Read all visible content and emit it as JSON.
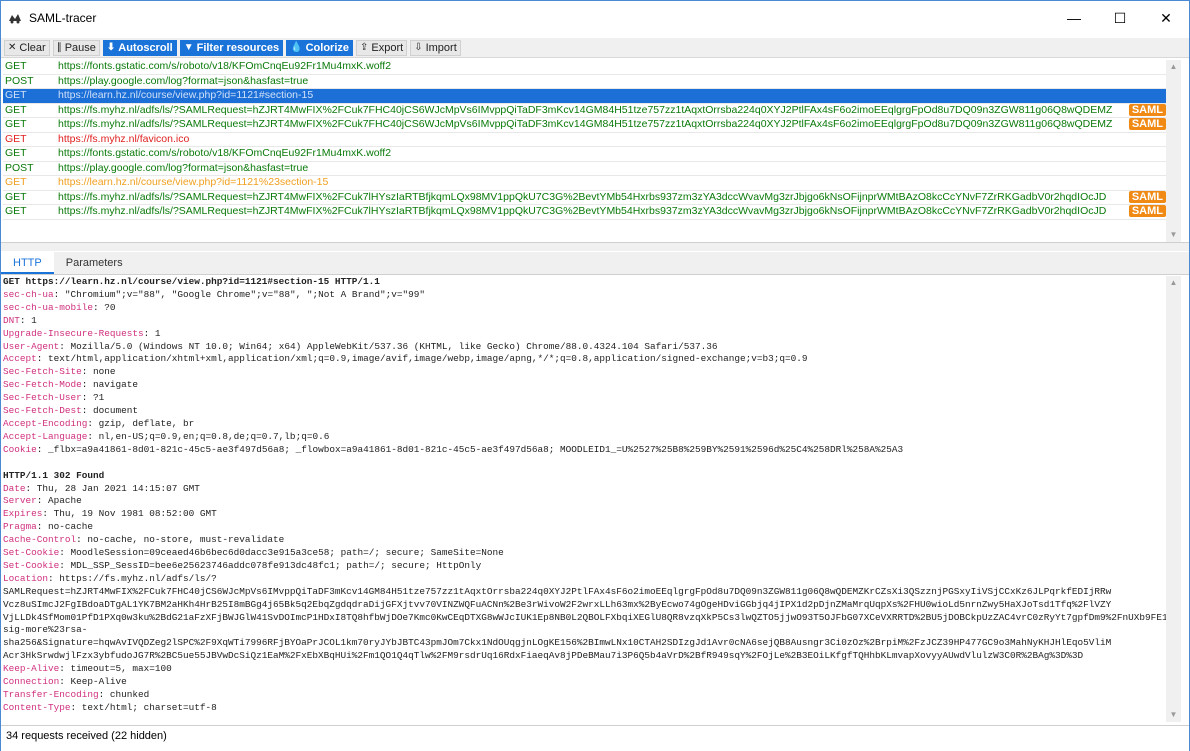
{
  "window": {
    "title": "SAML-tracer",
    "controls": {
      "minimize": "—",
      "maximize": "☐",
      "close": "✕"
    }
  },
  "toolbar": {
    "clear": "Clear",
    "pause": "Pause",
    "autoscroll": "Autoscroll",
    "filter": "Filter resources",
    "colorize": "Colorize",
    "export": "Export",
    "import": "Import"
  },
  "requests": [
    {
      "method": "GET",
      "url": "https://fonts.gstatic.com/s/roboto/v18/KFOmCnqEu92Fr1Mu4mxK.woff2",
      "color": "green",
      "saml": false
    },
    {
      "method": "POST",
      "url": "https://play.google.com/log?format=json&hasfast=true",
      "color": "green",
      "saml": false
    },
    {
      "method": "GET",
      "url": "https://learn.hz.nl/course/view.php?id=1121#section-15",
      "color": "selected",
      "saml": false
    },
    {
      "method": "GET",
      "url": "https://fs.myhz.nl/adfs/ls/?SAMLRequest=hZJRT4MwFIX%2FCuk7FHC40jCS6WJcMpVs6IMvppQiTaDF3mKcv14GM84H51tze757zz1tAqxtOrrsba224q0XYJ2PtlFAx4sF6o2imoEEqlgrgFpOd8u7DQ09n3ZGW811g06Q8wQDEMZ",
      "color": "green",
      "saml": true
    },
    {
      "method": "GET",
      "url": "https://fs.myhz.nl/adfs/ls/?SAMLRequest=hZJRT4MwFIX%2FCuk7FHC40jCS6WJcMpVs6IMvppQiTaDF3mKcv14GM84H51tze757zz1tAqxtOrrsba224q0XYJ2PtlFAx4sF6o2imoEEqlgrgFpOd8u7DQ09n3ZGW811g06Q8wQDEMZ",
      "color": "green",
      "saml": true
    },
    {
      "method": "GET",
      "url": "https://fs.myhz.nl/favicon.ico",
      "color": "red",
      "saml": false
    },
    {
      "method": "GET",
      "url": "https://fonts.gstatic.com/s/roboto/v18/KFOmCnqEu92Fr1Mu4mxK.woff2",
      "color": "green",
      "saml": false
    },
    {
      "method": "POST",
      "url": "https://play.google.com/log?format=json&hasfast=true",
      "color": "green",
      "saml": false
    },
    {
      "method": "GET",
      "url": "https://learn.hz.nl/course/view.php?id=1121%23section-15",
      "color": "orange",
      "saml": false
    },
    {
      "method": "GET",
      "url": "https://fs.myhz.nl/adfs/ls/?SAMLRequest=hZJRT4MwFIX%2FCuk7lHYszIaRTBfjkqmLQx98MV1ppQkU7C3G%2BevtYMb54Hxrbs937zm3zYA3dccWvavMg3zrJbjgo6kNsOFijnprWMtBAzO8kcCcYNvF7ZrRKGadbV0r2hqdIOcJD",
      "color": "green",
      "saml": true
    },
    {
      "method": "GET",
      "url": "https://fs.myhz.nl/adfs/ls/?SAMLRequest=hZJRT4MwFIX%2FCuk7lHYszIaRTBfjkqmLQx98MV1ppQkU7C3G%2BevtYMb54Hxrbs937zm3zYA3dccWvavMg3zrJbjgo6kNsOFijnprWMtBAzO8kcCcYNvF7ZrRKGadbV0r2hqdIOcJD",
      "color": "green",
      "saml": true
    }
  ],
  "saml_badge": "SAML",
  "tabs": {
    "http": "HTTP",
    "parameters": "Parameters"
  },
  "request_line": "GET https://learn.hz.nl/course/view.php?id=1121#section-15 HTTP/1.1",
  "request_headers": [
    {
      "name": "sec-ch-ua",
      "value": "\"Chromium\";v=\"88\", \"Google Chrome\";v=\"88\", \";Not A Brand\";v=\"99\""
    },
    {
      "name": "sec-ch-ua-mobile",
      "value": "?0"
    },
    {
      "name": "DNT",
      "value": "1"
    },
    {
      "name": "Upgrade-Insecure-Requests",
      "value": "1"
    },
    {
      "name": "User-Agent",
      "value": "Mozilla/5.0 (Windows NT 10.0; Win64; x64) AppleWebKit/537.36 (KHTML, like Gecko) Chrome/88.0.4324.104 Safari/537.36"
    },
    {
      "name": "Accept",
      "value": "text/html,application/xhtml+xml,application/xml;q=0.9,image/avif,image/webp,image/apng,*/*;q=0.8,application/signed-exchange;v=b3;q=0.9"
    },
    {
      "name": "Sec-Fetch-Site",
      "value": "none"
    },
    {
      "name": "Sec-Fetch-Mode",
      "value": "navigate"
    },
    {
      "name": "Sec-Fetch-User",
      "value": "?1"
    },
    {
      "name": "Sec-Fetch-Dest",
      "value": "document"
    },
    {
      "name": "Accept-Encoding",
      "value": "gzip, deflate, br"
    },
    {
      "name": "Accept-Language",
      "value": "nl,en-US;q=0.9,en;q=0.8,de;q=0.7,lb;q=0.6"
    },
    {
      "name": "Cookie",
      "value": "_flbx=a9a41861-8d01-821c-45c5-ae3f497d56a8; _flowbox=a9a41861-8d01-821c-45c5-ae3f497d56a8; MOODLEID1_=U%2527%25B8%259BY%2591%2596d%25C4%258DRl%258A%25A3"
    }
  ],
  "response_line": "HTTP/1.1 302 Found",
  "response_headers_a": [
    {
      "name": "Date",
      "value": "Thu, 28 Jan 2021 14:15:07 GMT"
    },
    {
      "name": "Server",
      "value": "Apache"
    },
    {
      "name": "Expires",
      "value": "Thu, 19 Nov 1981 08:52:00 GMT"
    },
    {
      "name": "Pragma",
      "value": "no-cache"
    },
    {
      "name": "Cache-Control",
      "value": "no-cache, no-store, must-revalidate"
    },
    {
      "name": "Set-Cookie",
      "value": "MoodleSession=09ceaed46b6bec6d0dacc3e915a3ce58; path=/; secure; SameSite=None"
    },
    {
      "name": "Set-Cookie",
      "value": "MDL_SSP_SessID=bee6e25623746addc078fe913dc48fc1; path=/; secure; HttpOnly"
    }
  ],
  "location_name": "Location",
  "location_value": "https://fs.myhz.nl/adfs/ls/?SAMLRequest=hZJRT4MwFIX%2FCuk7FHC40jCS6WJcMpVs6IMvppQiTaDF3mKcv14GM84H51tze757zz1tAqxtOrrsba224q0XYJ2PtlFAx4sF6o2imoEEqlgrgFpOd8u7DQ09n3ZGW811g06Q8wQDEMZKrCZsXi3QSzznjPGSxyIiVSjCCxKz6JLPqrkfEDIjRRwVcz8uSImcJ2FgIBdoaDTgAL1YK7BM2aHKh4HrB25I8mBGg4j65Bk5q2EbqZgdqdraDijGFXjtvv70VINZWQFuACNn%2Be3rWivoW2F2wrxLLh63mx%2ByEcwo74gOgeHDviGGbjq4jIPX1d2pDjnZMaMrqUqpXs%2FHU0wioLd5nrnZwy5HaXJoTsd1Tfq%2FlVZYVjLLDk4SfMom01PfD1PXq0w3ku%2BdG21aFzXFjBWJGlW41SvDOImcP1HDxI8TQ8hfbWjDOe7Kmc0KwCEqDTXG8wWJcIUK1Ep8NB0L2QBOLFXbqiXEGlU8QR8vzqXkP5Cs3lwQZTO5jjwO93T5OJFbG07XCeVXRRTD%2BU5jDOBCkpUzZAC4vrC0zRyYt7gpfDm9%2FnUXb9FE1ukFqLfbMvOD7Dfqc0r7z67zO5mpNR%2BfgJ36zNUxQ",
  "location_wrapped": "https://fs.myhz.nl/adfs/ls/?\nSAMLRequest=hZJRT4MwFIX%2FCuk7FHC40jCS6WJcMpVs6IMvppQiTaDF3mKcv14GM84H51tze757zz1tAqxtOrrsba224q0XYJ2PtlFAx4sF6o2imoEEqlgrgFpOd8u7DQ09n3ZGW811g06Q8wQDEMZKrCZsXi3QSzznjPGSxyIiVSjCCxKz6JLPqrkfEDIjRRw\nVcz8uSImcJ2FgIBdoaDTgAL1YK7BM2aHKh4HrB25I8mBGg4j65Bk5q2EbqZgdqdraDijGFXjtvv70VINZWQFuACNn%2Be3rWivoW2F2wrxLLh63mx%2ByEcwo74gOgeHDviGGbjq4jIPX1d2pDjnZMaMrqUqpXs%2FHU0wioLd5nrnZwy5HaXJoTsd1Tfq%2FlVZY\nVjLLDk4SfMom01PfD1PXq0w3ku%2BdG21aFzXFjBWJGlW41SvDOImcP1HDxI8TQ8hfbWjDOe7Kmc0KwCEqDTXG8wWJcIUK1Ep8NB0L2QBOLFXbqiXEGlU8QR8vzqXkP5Cs3lwQZTO5jjwO93T5OJFbG07XCeVXRRTD%2BU5jDOBCkpUzZAC4vrC0zRyYt7gpfDm9%2FnUXb9FE1ukFqLfbMvOD7Dfqc0r7z67zO5mpNR%2BfgJ36zNUxQ&RelayState=https%3A%2F%2Flearn.hz.nl%2Fcourse%2Fview.php%3Fid%3D1121&SigAlg=http%3A%2F%2Fwww.w3.org%2F2001%2F04%2Fxmld\nsig-more%23rsa-\nsha256&Signature=hqwAvIVQDZeg2lSPC%2F9XqWTi7996RFjBYOaPrJCOL1km70ryJYbJBTC43pmJOm7Ckx1NdOUqgjnLOgKE156%2BImwLNx10CTAH2SDIzgJd1Avr0cNA6sejQB8Ausngr3Ci0zOz%2BrpiM%2FzJCZ39HP477GC9o3MahNyKHJHlEqo5VliM\nAcr3HkSrwdwjlFzx3ybfudoJG7R%2BC5ue55JBVwDcSiQz1EaM%2FxEbXBqHUi%2Fm1QO1Q4qTlw%2FM9rsdrUq16RdxFiaeqAv8jPDeBMau7i3P6Q5b4aVrD%2BfR949sqY%2FOjLe%2B3EOiLKfgfTQHhbKLmvapXovyyAUwdVlulzW3C0R%2BAg%3D%3D",
  "response_headers_b": [
    {
      "name": "Keep-Alive",
      "value": "timeout=5, max=100"
    },
    {
      "name": "Connection",
      "value": "Keep-Alive"
    },
    {
      "name": "Transfer-Encoding",
      "value": "chunked"
    },
    {
      "name": "Content-Type",
      "value": "text/html; charset=utf-8"
    }
  ],
  "status": "34 requests received (22 hidden)"
}
